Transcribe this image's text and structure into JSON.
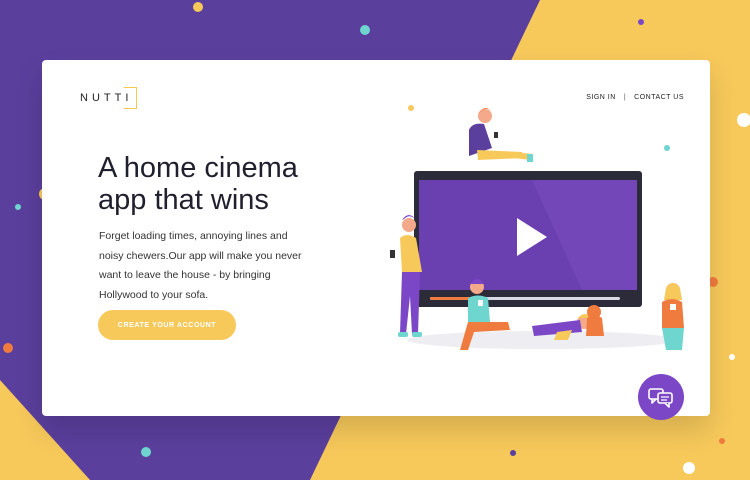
{
  "brand": {
    "logo_text": "NUTTI"
  },
  "nav": {
    "sign_in": "SIGN IN",
    "separator": "|",
    "contact": "CONTACT US"
  },
  "hero": {
    "headline_line1": "A home cinema",
    "headline_line2": "app that wins",
    "desc_line1": "Forget loading times, annoying lines and",
    "desc_line2": "noisy chewers.Our app will make you never",
    "desc_line3": "want to leave the house - by bringing",
    "desc_line4": "Hollywood to your sofa.",
    "cta_label": "CREATE YOUR ACCOUNT"
  },
  "icons": {
    "chat": "chat-bubbles-icon",
    "play": "play-icon"
  },
  "colors": {
    "purple": "#5b3f9d",
    "yellow": "#f7c95b",
    "accent_purple": "#7c47c7",
    "teal": "#6fd6cf",
    "orange": "#f07b3f"
  }
}
